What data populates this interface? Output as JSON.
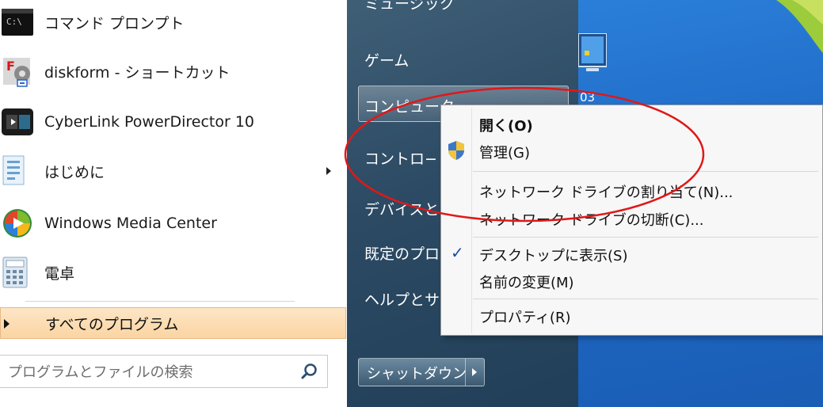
{
  "start_menu": {
    "programs": [
      {
        "label": "コマンド プロンプト",
        "icon": "cmd-icon"
      },
      {
        "label": "diskform - ショートカット",
        "icon": "diskform-icon"
      },
      {
        "label": "CyberLink PowerDirector 10",
        "icon": "powerdirector-icon"
      },
      {
        "label": "はじめに",
        "icon": "getting-started-icon",
        "has_submenu": true
      },
      {
        "label": "Windows Media Center",
        "icon": "media-center-icon"
      },
      {
        "label": "電卓",
        "icon": "calculator-icon"
      }
    ],
    "all_programs_label": "すべてのプログラム",
    "search_placeholder": "プログラムとファイルの検索"
  },
  "right_panel": {
    "items": [
      "ミュージック",
      "ゲーム",
      "コンピューター",
      "コントロ−",
      "デバイスと",
      "既定のプロ",
      "ヘルプとサ"
    ],
    "shutdown_label": "シャットダウン"
  },
  "context_menu": {
    "items": [
      "開く(O)",
      "管理(G)",
      "ネットワーク ドライブの割り当て(N)...",
      "ネットワーク ドライブの切断(C)...",
      "デスクトップに表示(S)",
      "名前の変更(M)",
      "プロパティ(R)"
    ],
    "checkmark": "✓"
  },
  "desktop": {
    "icon_caption": "03"
  },
  "colors": {
    "highlight_ellipse": "#e01818",
    "start_panel": "#2c4a63",
    "desktop": "#1f6bc7",
    "all_programs_bg": "#fcd9ab"
  }
}
